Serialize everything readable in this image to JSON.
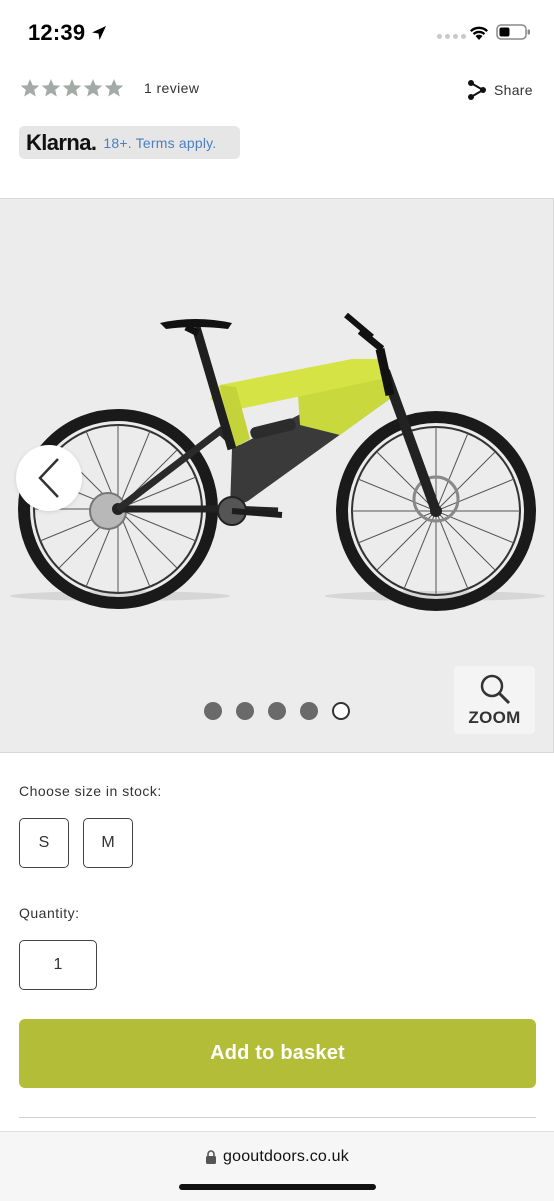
{
  "status_bar": {
    "time": "12:39",
    "icons": [
      "location-arrow-icon",
      "signal-dots-icon",
      "wifi-icon",
      "battery-icon"
    ]
  },
  "product": {
    "rating_stars": 5,
    "rating_color": "#a2aba5",
    "review_count": "1 review",
    "share_label": "Share",
    "klarna_logo": "Klarna.",
    "klarna_terms": "18+. Terms apply."
  },
  "gallery": {
    "image_count": 5,
    "active_index": 4,
    "zoom_label": "ZOOM",
    "icons": [
      "chevron-left-icon",
      "zoom-icon"
    ]
  },
  "size": {
    "label": "Choose size in stock:",
    "options": [
      "S",
      "M"
    ]
  },
  "quantity": {
    "label": "Quantity:",
    "value": "1"
  },
  "basket": {
    "label": "Add to basket",
    "color": "#b3bd38"
  },
  "browser": {
    "url": "gooutdoors.co.uk"
  }
}
